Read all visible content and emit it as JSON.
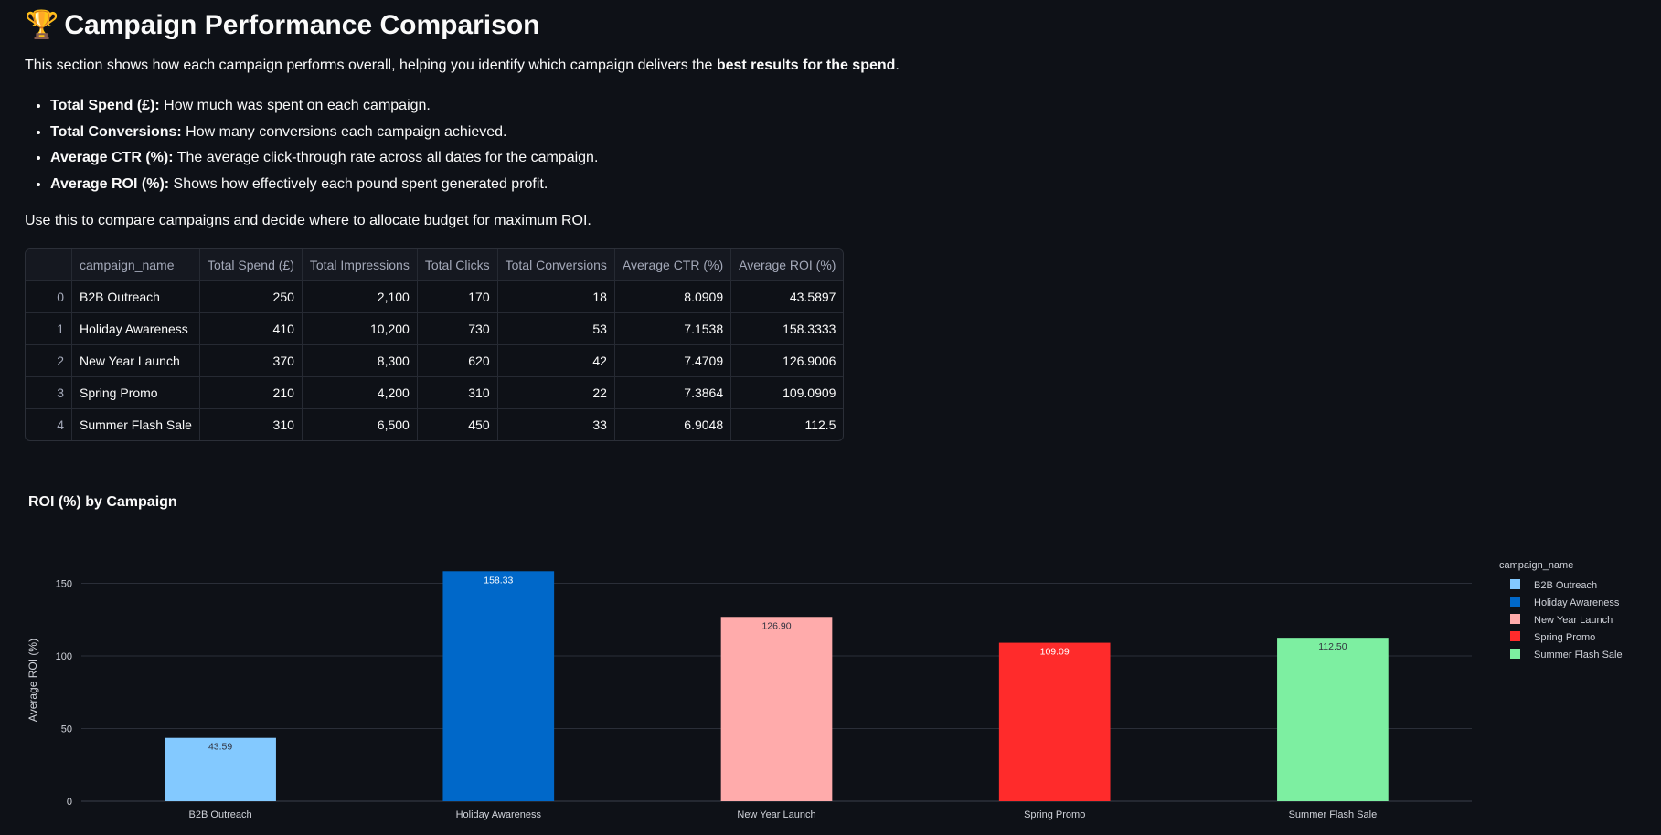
{
  "header": {
    "icon": "trophy-icon",
    "title": "Campaign Performance Comparison"
  },
  "intro": {
    "text_prefix": "This section shows how each campaign performs overall, helping you identify which campaign delivers the ",
    "text_bold": "best results for the spend",
    "text_suffix": "."
  },
  "bullets": [
    {
      "term": "Total Spend (£):",
      "desc": " How much was spent on each campaign."
    },
    {
      "term": "Total Conversions:",
      "desc": " How many conversions each campaign achieved."
    },
    {
      "term": "Average CTR (%):",
      "desc": " The average click-through rate across all dates for the campaign."
    },
    {
      "term": "Average ROI (%):",
      "desc": " Shows how effectively each pound spent generated profit."
    }
  ],
  "usage_text": "Use this to compare campaigns and decide where to allocate budget for maximum ROI.",
  "table": {
    "columns": [
      "",
      "campaign_name",
      "Total Spend (£)",
      "Total Impressions",
      "Total Clicks",
      "Total Conversions",
      "Average CTR (%)",
      "Average ROI (%)"
    ],
    "rows": [
      [
        "0",
        "B2B Outreach",
        "250",
        "2,100",
        "170",
        "18",
        "8.0909",
        "43.5897"
      ],
      [
        "1",
        "Holiday Awareness",
        "410",
        "10,200",
        "730",
        "53",
        "7.1538",
        "158.3333"
      ],
      [
        "2",
        "New Year Launch",
        "370",
        "8,300",
        "620",
        "42",
        "7.4709",
        "126.9006"
      ],
      [
        "3",
        "Spring Promo",
        "210",
        "4,200",
        "310",
        "22",
        "7.3864",
        "109.0909"
      ],
      [
        "4",
        "Summer Flash Sale",
        "310",
        "6,500",
        "450",
        "33",
        "6.9048",
        "112.5"
      ]
    ]
  },
  "chart_data": {
    "type": "bar",
    "title": "ROI (%) by Campaign",
    "categories": [
      "B2B Outreach",
      "Holiday Awareness",
      "New Year Launch",
      "Spring Promo",
      "Summer Flash Sale"
    ],
    "values": [
      43.59,
      158.33,
      126.9,
      109.09,
      112.5
    ],
    "value_labels": [
      "43.59",
      "158.33",
      "126.90",
      "109.09",
      "112.50"
    ],
    "colors": [
      "#83c9ff",
      "#0068c9",
      "#ffabab",
      "#ff2b2b",
      "#7defa1"
    ],
    "label_colors": [
      "#31333f",
      "#ffffff",
      "#31333f",
      "#ffffff",
      "#31333f"
    ],
    "ylabel": "Average ROI (%)",
    "xlabel": "",
    "yticks": [
      0,
      50,
      100,
      150
    ],
    "ylim": [
      0,
      166.7
    ],
    "grid": true,
    "legend_title": "campaign_name",
    "legend_position": "right"
  }
}
